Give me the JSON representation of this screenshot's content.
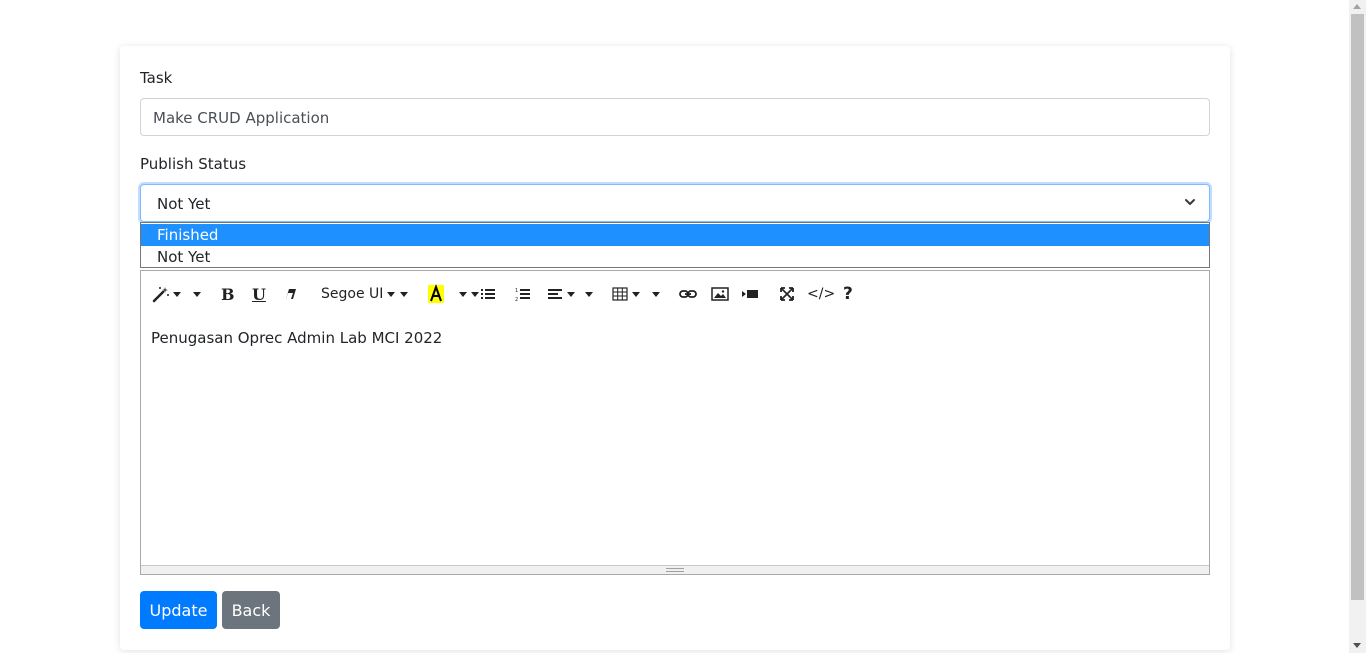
{
  "form": {
    "task_label": "Task",
    "task_value": "Make CRUD Application",
    "status_label": "Publish Status",
    "status_value": "Not Yet",
    "status_options": [
      "Finished",
      "Not Yet"
    ]
  },
  "editor": {
    "font_name": "Segoe UI",
    "content": "Penugasan Oprec Admin Lab MCI 2022",
    "code_view_label": "</>",
    "help_label": "?",
    "icons": [
      "magic-icon",
      "bold-icon",
      "underline-icon",
      "eraser-icon",
      "font-color-icon",
      "unordered-list-icon",
      "ordered-list-icon",
      "align-icon",
      "table-icon",
      "link-icon",
      "picture-icon",
      "video-icon",
      "fullscreen-icon",
      "code-view-icon",
      "help-icon"
    ]
  },
  "buttons": {
    "update_label": "Update",
    "back_label": "Back"
  },
  "colors": {
    "primary": "#007bff",
    "secondary": "#6c757d",
    "highlight": "#1e90ff"
  }
}
